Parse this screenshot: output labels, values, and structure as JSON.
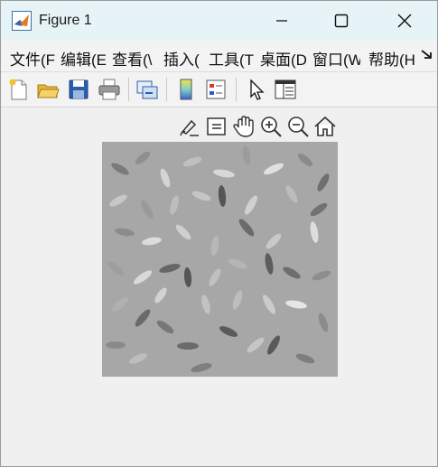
{
  "window": {
    "title": "Figure 1",
    "controls": {
      "minimize_icon": "minimize-icon",
      "maximize_icon": "maximize-icon",
      "close_icon": "close-icon"
    }
  },
  "menu": {
    "items": [
      {
        "label": "文件(F"
      },
      {
        "label": "编辑(E"
      },
      {
        "label": "查看(\\"
      },
      {
        "label": "插入("
      },
      {
        "label": "工具(T"
      },
      {
        "label": "桌面(D"
      },
      {
        "label": "窗口(W"
      },
      {
        "label": "帮助(H"
      }
    ],
    "overflow_icon": "overflow-arrow-icon"
  },
  "toolbar": {
    "buttons": [
      {
        "icon": "new-figure-icon"
      },
      {
        "icon": "open-file-icon"
      },
      {
        "icon": "save-icon"
      },
      {
        "icon": "print-icon"
      },
      {
        "icon": "link-plot-icon"
      },
      {
        "icon": "insert-colorbar-icon"
      },
      {
        "icon": "insert-legend-icon"
      },
      {
        "icon": "edit-plot-pointer-icon"
      },
      {
        "icon": "property-inspector-icon"
      }
    ]
  },
  "axes_toolbar": {
    "buttons": [
      {
        "icon": "brush-data-icon"
      },
      {
        "icon": "datatip-icon"
      },
      {
        "icon": "pan-hand-icon"
      },
      {
        "icon": "zoom-in-icon"
      },
      {
        "icon": "zoom-out-icon"
      },
      {
        "icon": "home-restore-view-icon"
      }
    ]
  },
  "figure": {
    "content": "grayscale image of rice grains",
    "background_color": "#a7a7a7"
  },
  "colors": {
    "titlebar": "#e6f4f8",
    "window_bg": "#f0f0f0",
    "save_blue": "#2b5fad",
    "folder_yellow": "#e8b43b"
  }
}
